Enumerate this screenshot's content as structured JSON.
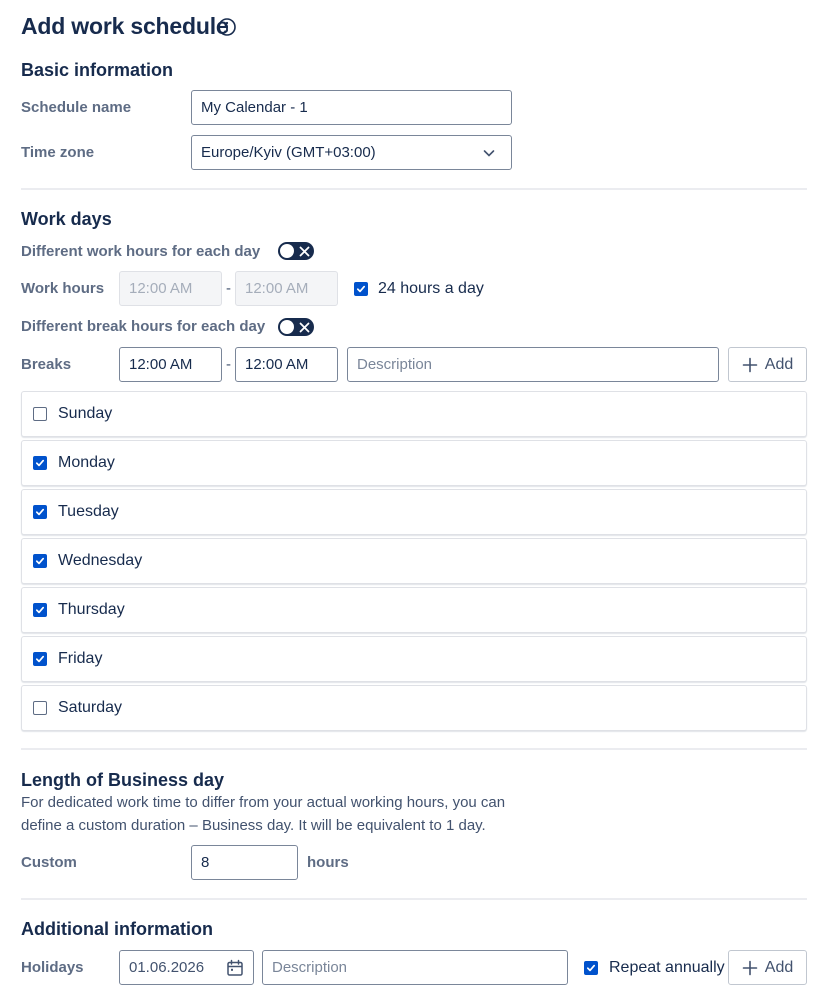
{
  "header": {
    "title": "Add work schedule",
    "info_icon": "info-icon"
  },
  "basic": {
    "title": "Basic information",
    "schedule_name_label": "Schedule name",
    "schedule_name_value": "My Calendar - 1",
    "timezone_label": "Time zone",
    "timezone_value": "Europe/Kyiv (GMT+03:00)"
  },
  "work_days": {
    "title": "Work days",
    "diff_hours_label": "Different work hours for each day",
    "diff_hours_on": false,
    "work_hours_label": "Work hours",
    "work_start": "12:00 AM",
    "work_end": "12:00 AM",
    "dash": "-",
    "all_day_label": "24 hours a day",
    "all_day_checked": true,
    "diff_breaks_label": "Different break hours for each day",
    "diff_breaks_on": false,
    "breaks_label": "Breaks",
    "break_start": "12:00 AM",
    "break_end": "12:00 AM",
    "break_desc_placeholder": "Description",
    "add_label": "Add",
    "days": [
      {
        "label": "Sunday",
        "checked": false
      },
      {
        "label": "Monday",
        "checked": true
      },
      {
        "label": "Tuesday",
        "checked": true
      },
      {
        "label": "Wednesday",
        "checked": true
      },
      {
        "label": "Thursday",
        "checked": true
      },
      {
        "label": "Friday",
        "checked": true
      },
      {
        "label": "Saturday",
        "checked": false
      }
    ]
  },
  "business_day": {
    "title": "Length of Business day",
    "help_line1": "For dedicated work time to differ from your actual working hours, you can",
    "help_line2": "define a custom duration – Business day. It will be equivalent to 1 day.",
    "custom_label": "Custom",
    "custom_value": "8",
    "unit": "hours"
  },
  "additional": {
    "title": "Additional information",
    "holidays_label": "Holidays",
    "holiday_date": "01.06.2026",
    "holiday_desc_placeholder": "Description",
    "repeat_label": "Repeat annually",
    "repeat_checked": true,
    "add_label": "Add"
  },
  "colors": {
    "primary": "#0052cc",
    "text": "#172b4d",
    "label": "#5e6c84"
  }
}
